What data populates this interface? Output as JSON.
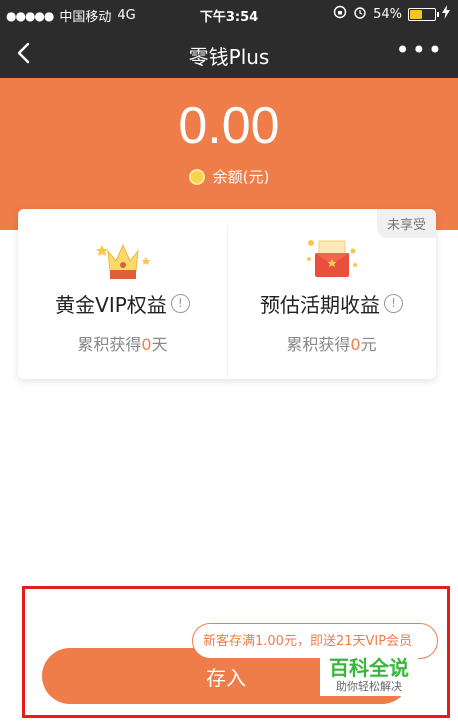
{
  "status_bar": {
    "signal": "●●●●●",
    "carrier": "中国移动",
    "network": "4G",
    "time": "下午3:54",
    "battery_percent": "54%",
    "battery_level": 0.54
  },
  "nav": {
    "title": "零钱Plus",
    "more": "•••"
  },
  "balance": {
    "amount": "0.00",
    "label": "余额(元)"
  },
  "benefits": {
    "badge": "未享受",
    "vip": {
      "title": "黄金VIP权益",
      "prefix": "累积获得",
      "value": "0",
      "unit": "天"
    },
    "interest": {
      "title": "预估活期收益",
      "prefix": "累积获得",
      "value": "0",
      "unit": "元"
    }
  },
  "deposit": {
    "button_label": "存入",
    "promo_text": "新客存满1.00元，即送21天VIP会员"
  },
  "watermark": {
    "main": "百科全说",
    "sub": "助你轻松解决"
  },
  "colors": {
    "accent": "#ef7d4a",
    "header": "#2c2c2c",
    "highlight": "#e81b1b"
  }
}
